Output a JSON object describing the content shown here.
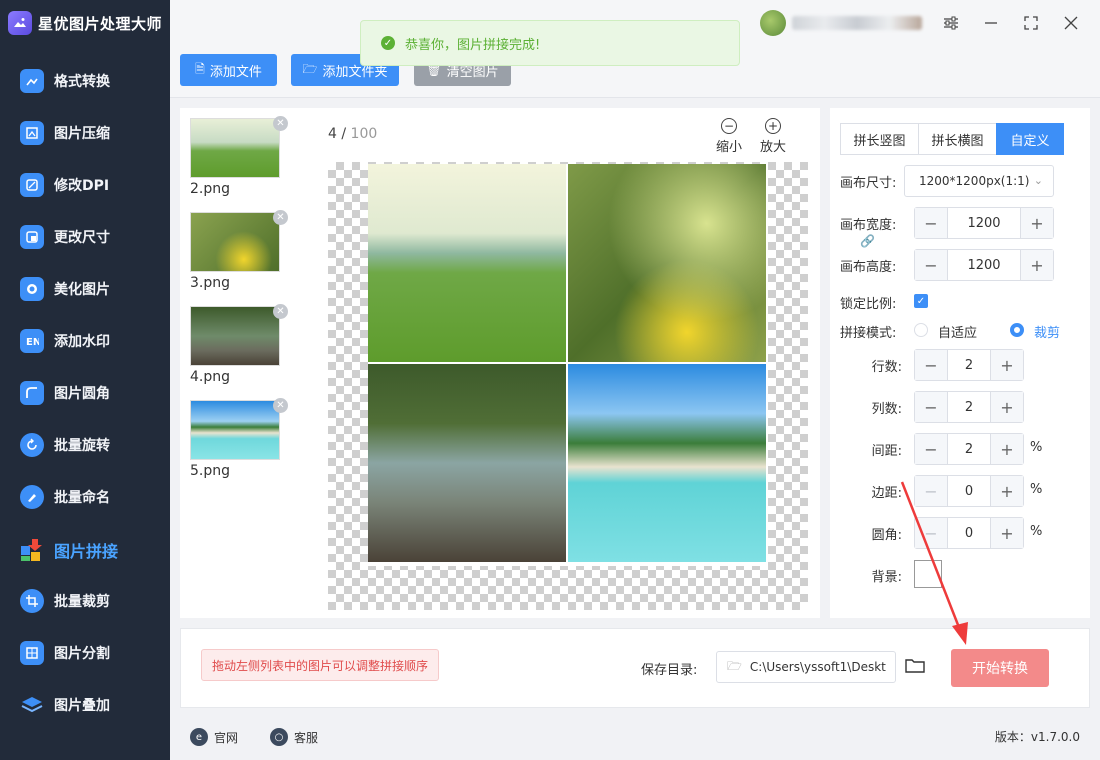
{
  "app": {
    "title": "星优图片处理大师"
  },
  "sidebar": {
    "items": [
      {
        "label": "格式转换",
        "icon": "image-convert-icon",
        "color": "#3d8ff7"
      },
      {
        "label": "图片压缩",
        "icon": "image-compress-icon",
        "color": "#3d8ff7"
      },
      {
        "label": "修改DPI",
        "icon": "dpi-icon",
        "color": "#3d8ff7"
      },
      {
        "label": "更改尺寸",
        "icon": "resize-icon",
        "color": "#3d8ff7"
      },
      {
        "label": "美化图片",
        "icon": "beautify-icon",
        "color": "#3d8ff7"
      },
      {
        "label": "添加水印",
        "icon": "watermark-icon",
        "color": "#3d8ff7"
      },
      {
        "label": "图片圆角",
        "icon": "round-corner-icon",
        "color": "#3d8ff7"
      },
      {
        "label": "批量旋转",
        "icon": "rotate-icon",
        "color": "#3d8ff7"
      },
      {
        "label": "批量命名",
        "icon": "rename-icon",
        "color": "#3d8ff7"
      },
      {
        "label": "图片拼接",
        "icon": "puzzle-icon",
        "color": "#f04a3a",
        "active": true
      },
      {
        "label": "批量裁剪",
        "icon": "crop-icon",
        "color": "#3d8ff7"
      },
      {
        "label": "图片分割",
        "icon": "split-icon",
        "color": "#3d8ff7"
      },
      {
        "label": "图片叠加",
        "icon": "layers-icon",
        "color": "#3d8ff7"
      }
    ]
  },
  "toolbar": {
    "add_file": "添加文件",
    "add_folder": "添加文件夹",
    "clear": "清空图片"
  },
  "toast": {
    "message": "恭喜你，图片拼接完成!"
  },
  "thumbnails": [
    {
      "name": "2.png"
    },
    {
      "name": "3.png"
    },
    {
      "name": "4.png"
    },
    {
      "name": "5.png"
    }
  ],
  "preview": {
    "current": "4",
    "total": "100",
    "separator": "/",
    "zoom_out": "缩小",
    "zoom_in": "放大"
  },
  "settings": {
    "tabs": [
      "拼长竖图",
      "拼长横图",
      "自定义"
    ],
    "active_tab": 2,
    "canvas_size_label": "画布尺寸:",
    "canvas_size_value": "1200*1200px(1:1)",
    "canvas_width_label": "画布宽度:",
    "canvas_width": "1200",
    "canvas_height_label": "画布高度:",
    "canvas_height": "1200",
    "lock_ratio_label": "锁定比例:",
    "lock_ratio": true,
    "mode_label": "拼接模式:",
    "mode_options": [
      "自适应",
      "裁剪"
    ],
    "mode_selected": "裁剪",
    "rows_label": "行数:",
    "rows": "2",
    "cols_label": "列数:",
    "cols": "2",
    "spacing_label": "间距:",
    "spacing": "2",
    "margin_label": "边距:",
    "margin": "0",
    "radius_label": "圆角:",
    "radius": "0",
    "background_label": "背景:",
    "percent": "%"
  },
  "bottom": {
    "hint": "拖动左侧列表中的图片可以调整拼接顺序",
    "save_label": "保存目录:",
    "save_path": "C:\\Users\\yssoft1\\Deskt",
    "start": "开始转换"
  },
  "footer": {
    "website": "官网",
    "support": "客服",
    "version": "版本：v1.7.0.0"
  },
  "colors": {
    "accent": "#3d8ff7",
    "sidebar_bg": "#222b3a",
    "start_button": "#f38a8a",
    "toast_text": "#5cb135"
  }
}
